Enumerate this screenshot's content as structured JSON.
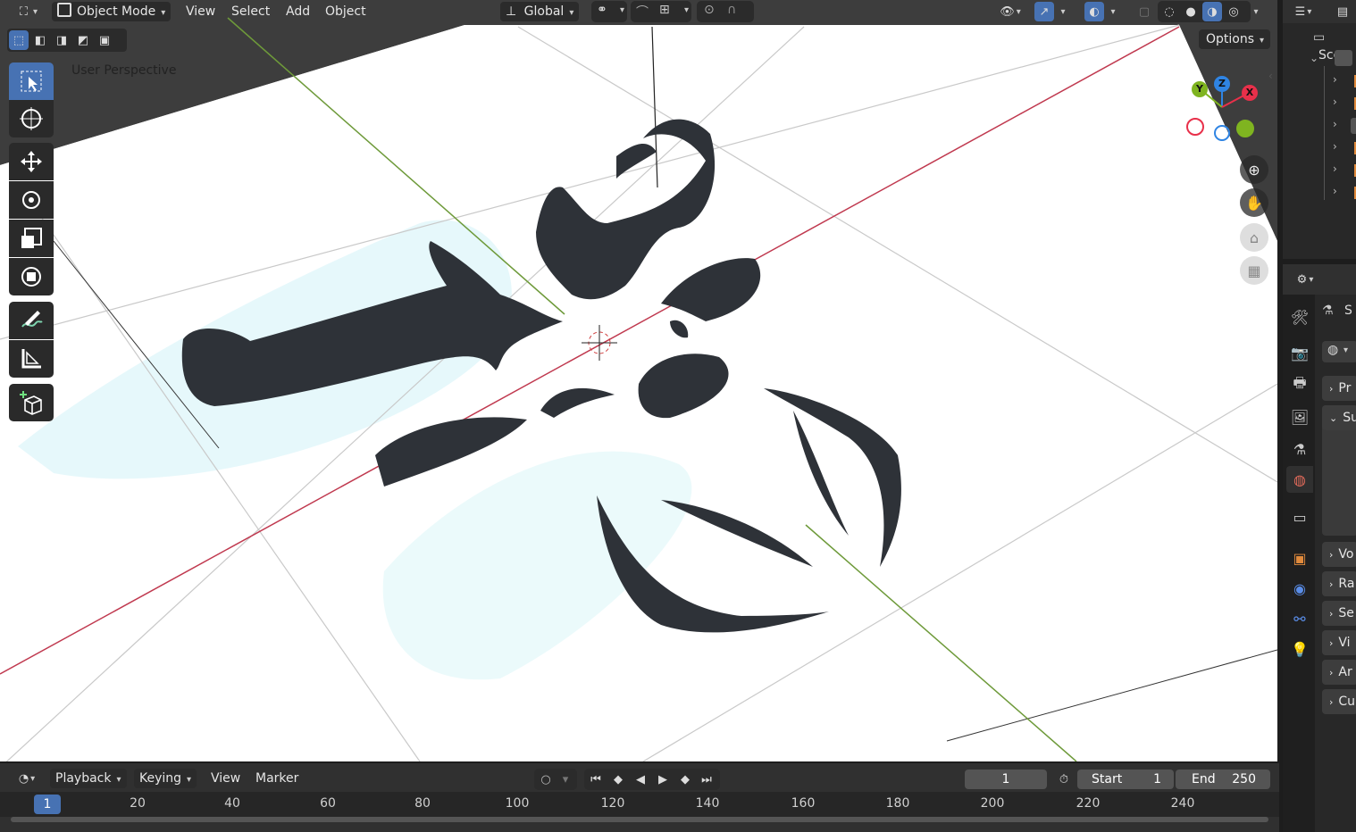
{
  "header": {
    "mode_label": "Object Mode",
    "menus": [
      "View",
      "Select",
      "Add",
      "Object"
    ],
    "orientation_label": "Global",
    "options_label": "Options"
  },
  "viewport": {
    "overlay_text": "User Perspective",
    "gizmo": {
      "x": "X",
      "y": "Y",
      "z": "Z"
    }
  },
  "toolbar": {
    "tools": [
      "select-box",
      "cursor",
      "move",
      "rotate",
      "scale",
      "transform",
      "annotate",
      "measure",
      "add-cube"
    ],
    "active_tool": "select-box"
  },
  "outliner": {
    "header_text": "Scer",
    "rows_visible": 6
  },
  "properties": {
    "header_text": "S",
    "sections": [
      "Pr",
      "Su",
      "Vo",
      "Ra",
      "Se",
      "Vi",
      "Ar",
      "Cu"
    ]
  },
  "timeline": {
    "menus": {
      "playback": "Playback",
      "keying": "Keying",
      "view": "View",
      "marker": "Marker"
    },
    "current_frame": "1",
    "start_label": "Start",
    "start_value": "1",
    "end_label": "End",
    "end_value": "250",
    "ruler_current": "1",
    "ruler_labels": [
      "20",
      "40",
      "60",
      "80",
      "100",
      "120",
      "140",
      "160",
      "180",
      "200",
      "220",
      "240"
    ]
  },
  "colors": {
    "accent": "#4772b3",
    "axis_x": "#e8304a",
    "axis_y": "#7fb420",
    "axis_z": "#2f84e3",
    "panel_bg": "#282828"
  }
}
